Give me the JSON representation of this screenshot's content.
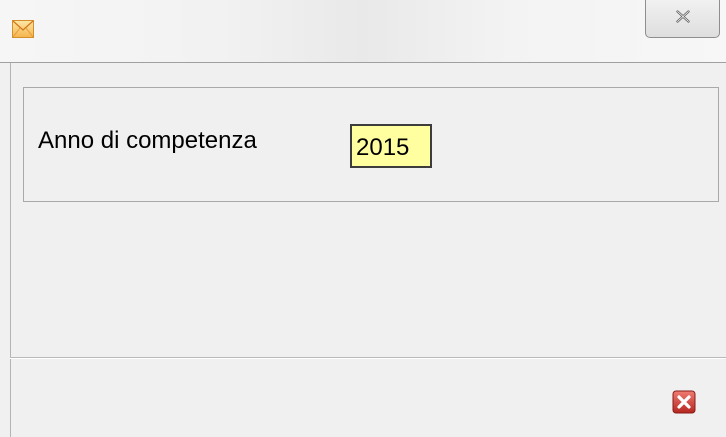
{
  "window": {
    "title_icon": "envelope-icon",
    "close_icon": "close-icon"
  },
  "form": {
    "year_label": "Anno di competenza",
    "year_value": "2015"
  },
  "footer": {
    "exit_icon": "exit-icon"
  },
  "colors": {
    "window_bg": "#f0f0f0",
    "input_bg": "#ffffa0",
    "exit_red": "#c8302a"
  }
}
